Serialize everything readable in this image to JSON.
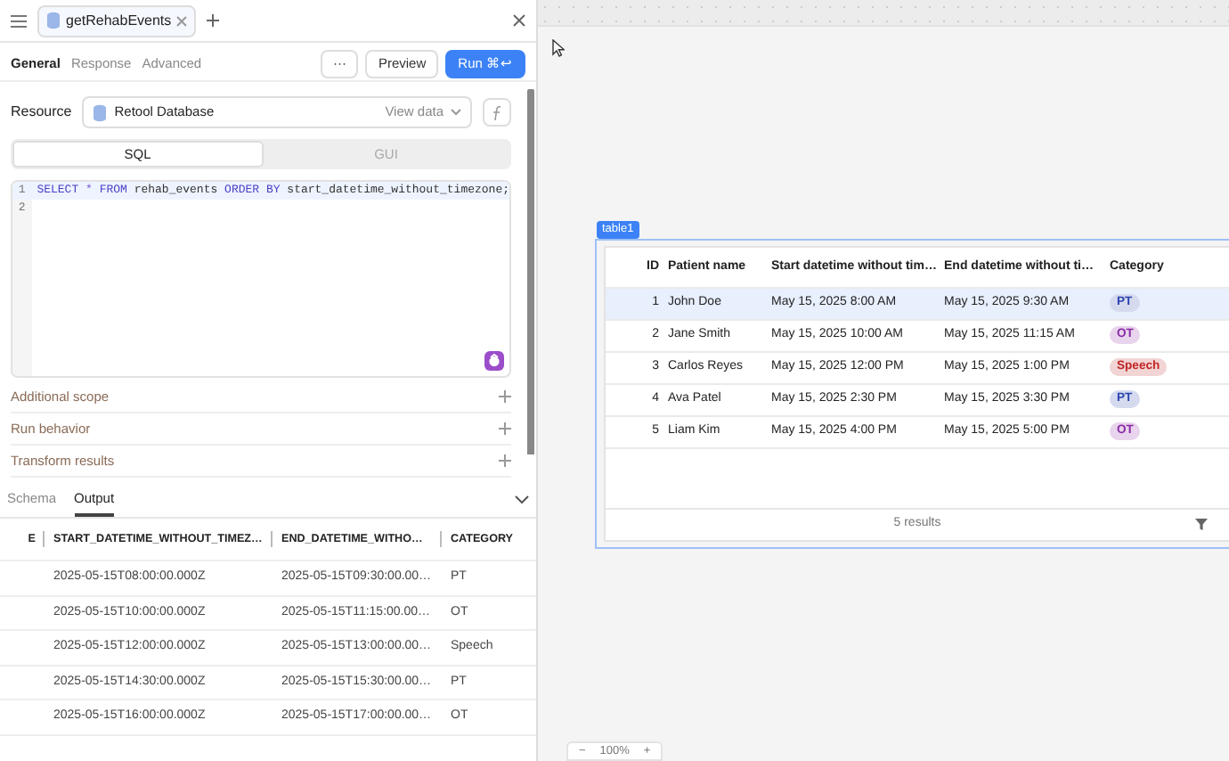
{
  "editor_tabs": [
    {
      "label": "getRehabEvents"
    }
  ],
  "query_tabs": [
    {
      "label": "General",
      "selected": true
    },
    {
      "label": "Response",
      "selected": false
    },
    {
      "label": "Advanced",
      "selected": false
    }
  ],
  "actions": {
    "more": "···",
    "preview": "Preview",
    "run": "Run",
    "run_shortcut": "⌘↩"
  },
  "resource": {
    "label": "Resource",
    "value": "Retool Database",
    "action": "View data"
  },
  "mode_tabs": [
    {
      "label": "SQL",
      "selected": true
    },
    {
      "label": "GUI",
      "selected": false
    }
  ],
  "editor": {
    "lines": [
      {
        "number": "1",
        "selected": true,
        "tokens": [
          {
            "kind": "keyword",
            "text": "SELECT"
          },
          {
            "kind": "operator",
            "text": "*"
          },
          {
            "kind": "keyword",
            "text": "FROM"
          },
          {
            "kind": "plain",
            "text": "rehab_events"
          },
          {
            "kind": "keyword",
            "text": "ORDER BY"
          },
          {
            "kind": "plain",
            "text": "start_datetime_without_timezone;"
          }
        ]
      },
      {
        "number": "2",
        "selected": false
      }
    ]
  },
  "sections": [
    "Additional scope",
    "Run behavior",
    "Transform results"
  ],
  "results_tabs": [
    {
      "label": "Schema",
      "selected": false
    },
    {
      "label": "Output",
      "selected": true
    }
  ],
  "output_table": {
    "columns": [
      "E",
      "START_DATETIME_WITHOUT_TIMEZ…",
      "END_DATETIME_WITHO…",
      "CATEGORY"
    ],
    "rows": [
      {
        "start": "2025-05-15T08:00:00.000Z",
        "end": "2025-05-15T09:30:00.00…",
        "category": "PT"
      },
      {
        "start": "2025-05-15T10:00:00.000Z",
        "end": "2025-05-15T11:15:00.00…",
        "category": "OT"
      },
      {
        "start": "2025-05-15T12:00:00.000Z",
        "end": "2025-05-15T13:00:00.00…",
        "category": "Speech"
      },
      {
        "start": "2025-05-15T14:30:00.000Z",
        "end": "2025-05-15T15:30:00.00…",
        "category": "PT"
      },
      {
        "start": "2025-05-15T16:00:00.000Z",
        "end": "2025-05-15T17:00:00.00…",
        "category": "OT"
      }
    ]
  },
  "canvas": {
    "component_label": "table1",
    "table": {
      "columns": [
        "ID",
        "Patient name",
        "Start datetime without tim…",
        "End datetime without ti…",
        "Category"
      ],
      "rows": [
        {
          "id": "1",
          "patient_name": "John Doe",
          "start": "May 15, 2025 8:00 AM",
          "end": "May 15, 2025 9:30 AM",
          "category": {
            "label": "PT",
            "color": "#2c44b0"
          },
          "selected": true
        },
        {
          "id": "2",
          "patient_name": "Jane Smith",
          "start": "May 15, 2025 10:00 AM",
          "end": "May 15, 2025 11:15 AM",
          "category": {
            "label": "OT",
            "color": "#8a2aa6"
          },
          "selected": false
        },
        {
          "id": "3",
          "patient_name": "Carlos Reyes",
          "start": "May 15, 2025 12:00 PM",
          "end": "May 15, 2025 1:00 PM",
          "category": {
            "label": "Speech",
            "color": "#c02626"
          },
          "selected": false
        },
        {
          "id": "4",
          "patient_name": "Ava Patel",
          "start": "May 15, 2025 2:30 PM",
          "end": "May 15, 2025 3:30 PM",
          "category": {
            "label": "PT",
            "color": "#2c44b0"
          },
          "selected": false
        },
        {
          "id": "5",
          "patient_name": "Liam Kim",
          "start": "May 15, 2025 4:00 PM",
          "end": "May 15, 2025 5:00 PM",
          "category": {
            "label": "OT",
            "color": "#8a2aa6"
          },
          "selected": false
        }
      ],
      "footer": "5 results"
    },
    "zoom": {
      "minus": "−",
      "value": "100%",
      "plus": "+"
    }
  }
}
